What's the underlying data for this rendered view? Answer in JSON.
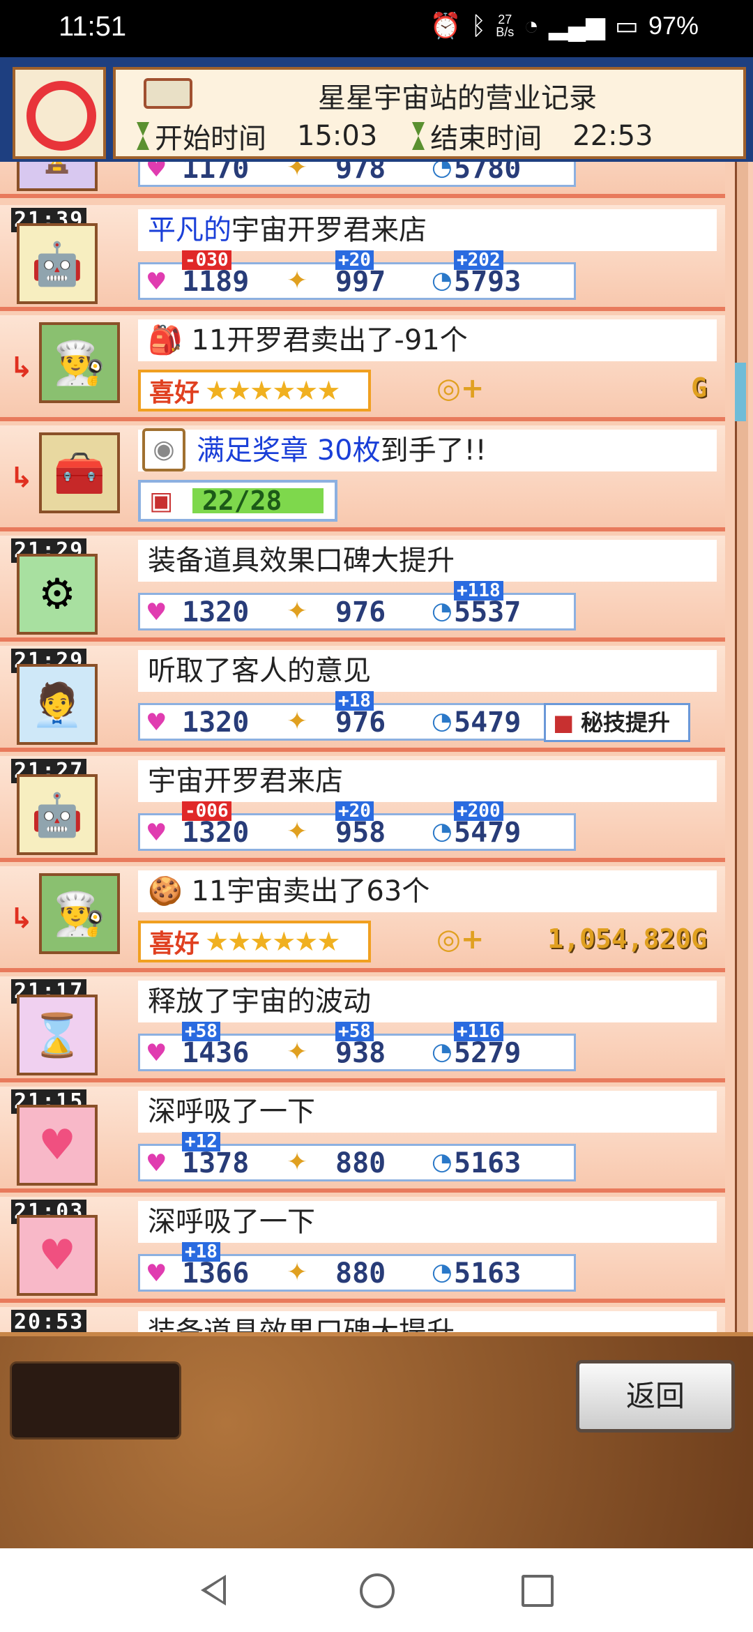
{
  "status_bar": {
    "time": "11:51",
    "network_speed": "27\nB/s",
    "battery": "97%"
  },
  "header": {
    "title": "星星宇宙站的营业记录",
    "start_label": "开始时间",
    "start_time": "15:03",
    "end_label": "结束时间",
    "end_time": "22:53"
  },
  "entries": [
    {
      "time": "",
      "message": "",
      "love": "1170",
      "spark": "978",
      "chat": "5780"
    },
    {
      "time": "21:39",
      "message_prefix": "平凡的",
      "message": "宇宙开罗君来店",
      "love": "1189",
      "spark": "997",
      "chat": "5793",
      "delta_love": "-030",
      "delta_spark": "+20",
      "delta_chat": "+202"
    },
    {
      "message": "11开罗君卖出了-91个",
      "pref_label": "喜好",
      "stars": "★★★★★★",
      "sales": "G"
    },
    {
      "message_blue": "满足奖章 30枚",
      "message": "到手了!!",
      "progress": "22/28"
    },
    {
      "time": "21:29",
      "message": "装备道具效果口碑大提升",
      "love": "1320",
      "spark": "976",
      "chat": "5537",
      "delta_chat": "+118"
    },
    {
      "time": "21:29",
      "message": "听取了客人的意见",
      "love": "1320",
      "spark": "976",
      "chat": "5479",
      "delta_spark": "+18",
      "skill": "秘技提升"
    },
    {
      "time": "21:27",
      "message": "宇宙开罗君来店",
      "love": "1320",
      "spark": "958",
      "chat": "5479",
      "delta_love": "-006",
      "delta_spark": "+20",
      "delta_chat": "+200"
    },
    {
      "message": "11宇宙卖出了63个",
      "pref_label": "喜好",
      "stars": "★★★★★★",
      "sales": "1,054,820G"
    },
    {
      "time": "21:17",
      "message": "释放了宇宙的波动",
      "love": "1436",
      "spark": "938",
      "chat": "5279",
      "delta_love": "+58",
      "delta_spark": "+58",
      "delta_chat": "+116"
    },
    {
      "time": "21:15",
      "message": "深呼吸了一下",
      "love": "1378",
      "spark": "880",
      "chat": "5163",
      "delta_love": "+12"
    },
    {
      "time": "21:03",
      "message": "深呼吸了一下",
      "love": "1366",
      "spark": "880",
      "chat": "5163",
      "delta_love": "+18"
    },
    {
      "time": "20:53",
      "message": "装备道具效果口碑大提升"
    }
  ],
  "footer": {
    "back_label": "返回"
  },
  "colors": {
    "header_bg": "#1e3f80",
    "row_border": "#e87a5c",
    "accent_blue": "#2a6be0",
    "negative_red": "#e02828"
  }
}
